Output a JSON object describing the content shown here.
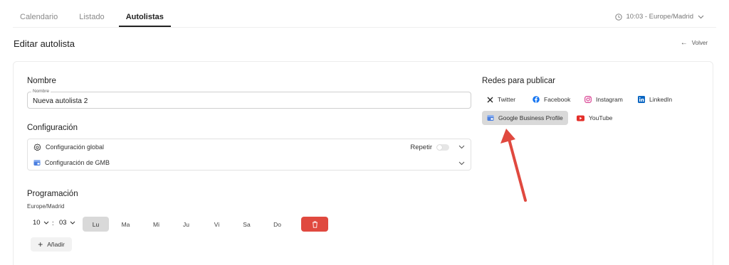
{
  "tabs": [
    {
      "label": "Calendario",
      "active": false
    },
    {
      "label": "Listado",
      "active": false
    },
    {
      "label": "Autolistas",
      "active": true
    }
  ],
  "timezone": {
    "label": "10:03 - Europe/Madrid",
    "icon": "clock-icon"
  },
  "page": {
    "title": "Editar autolista",
    "back_label": "Volver"
  },
  "nombre": {
    "section_title": "Nombre",
    "field_label": "Nombre",
    "value": "Nueva autolista 2"
  },
  "configuracion": {
    "section_title": "Configuración",
    "global_label": "Configuración global",
    "repeat_label": "Repetir",
    "repeat_enabled": false,
    "gmb_label": "Configuración de GMB"
  },
  "programacion": {
    "section_title": "Programación",
    "timezone": "Europe/Madrid",
    "hour": "10",
    "minute": "03",
    "separator": ":",
    "days": [
      {
        "label": "Lu",
        "active": true
      },
      {
        "label": "Ma",
        "active": false
      },
      {
        "label": "Mi",
        "active": false
      },
      {
        "label": "Ju",
        "active": false
      },
      {
        "label": "Vi",
        "active": false
      },
      {
        "label": "Sa",
        "active": false
      },
      {
        "label": "Do",
        "active": false
      }
    ],
    "add_label": "Añadir"
  },
  "redes": {
    "section_title": "Redes para publicar",
    "networks": [
      {
        "label": "Twitter",
        "icon": "x-twitter-icon",
        "selected": false
      },
      {
        "label": "Facebook",
        "icon": "facebook-icon",
        "selected": false
      },
      {
        "label": "Instagram",
        "icon": "instagram-icon",
        "selected": false
      },
      {
        "label": "LinkedIn",
        "icon": "linkedin-icon",
        "selected": false
      },
      {
        "label": "Google Business Profile",
        "icon": "google-business-icon",
        "selected": true
      },
      {
        "label": "YouTube",
        "icon": "youtube-icon",
        "selected": false
      }
    ]
  },
  "colors": {
    "accent": "#222222",
    "delete": "#e0493f",
    "annotation_arrow": "#e0493f",
    "selected_chip": "#d9d9d9"
  }
}
